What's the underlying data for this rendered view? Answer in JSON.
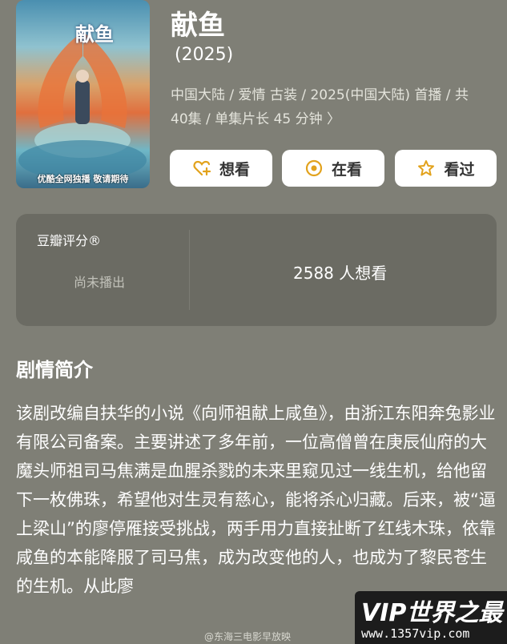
{
  "colors": {
    "page_bg": "#7f7f76",
    "card_bg": "#6b6b63",
    "button_bg": "#ffffff",
    "button_icon": "#e2a21c"
  },
  "poster": {
    "title_text": "献鱼",
    "caption": "优酷全网独播 敬请期待"
  },
  "show": {
    "title": "献鱼",
    "year": "(2025)",
    "meta_line1": "中国大陆 / 爱情 古装 / 2025(中国大陆) 首播 / 共",
    "meta_line2": "40集 / 单集片长 45 分钟 〉"
  },
  "actions": {
    "want_label": "想看",
    "want_icon": "heart-plus-icon",
    "watching_label": "在看",
    "watching_icon": "circle-dot-icon",
    "watched_label": "看过",
    "watched_icon": "star-icon"
  },
  "rating": {
    "label": "豆瓣评分®",
    "status": "尚未播出",
    "want_count": "2588 人想看"
  },
  "synopsis": {
    "title": "剧情简介",
    "text": "该剧改编自扶华的小说《向师祖献上咸鱼》，由浙江东阳奔兔影业有限公司备案。主要讲述了多年前，一位高僧曾在庚辰仙府的大魔头师祖司马焦满是血腥杀戮的未来里窥见过一线生机，给他留下一枚佛珠，希望他对生灵有慈心，能将杀心归藏。后来，被“逼上梁山”的廖停雁接受挑战，两手用力直接扯断了红线木珠，依靠咸鱼的本能降服了司马焦，成为改变他的人，也成为了黎民苍生的生机。从此廖"
  },
  "watermark": {
    "brand": "VIP世界之最",
    "url": "www.1357vip.com",
    "credit": "@东海三电影早放映"
  }
}
